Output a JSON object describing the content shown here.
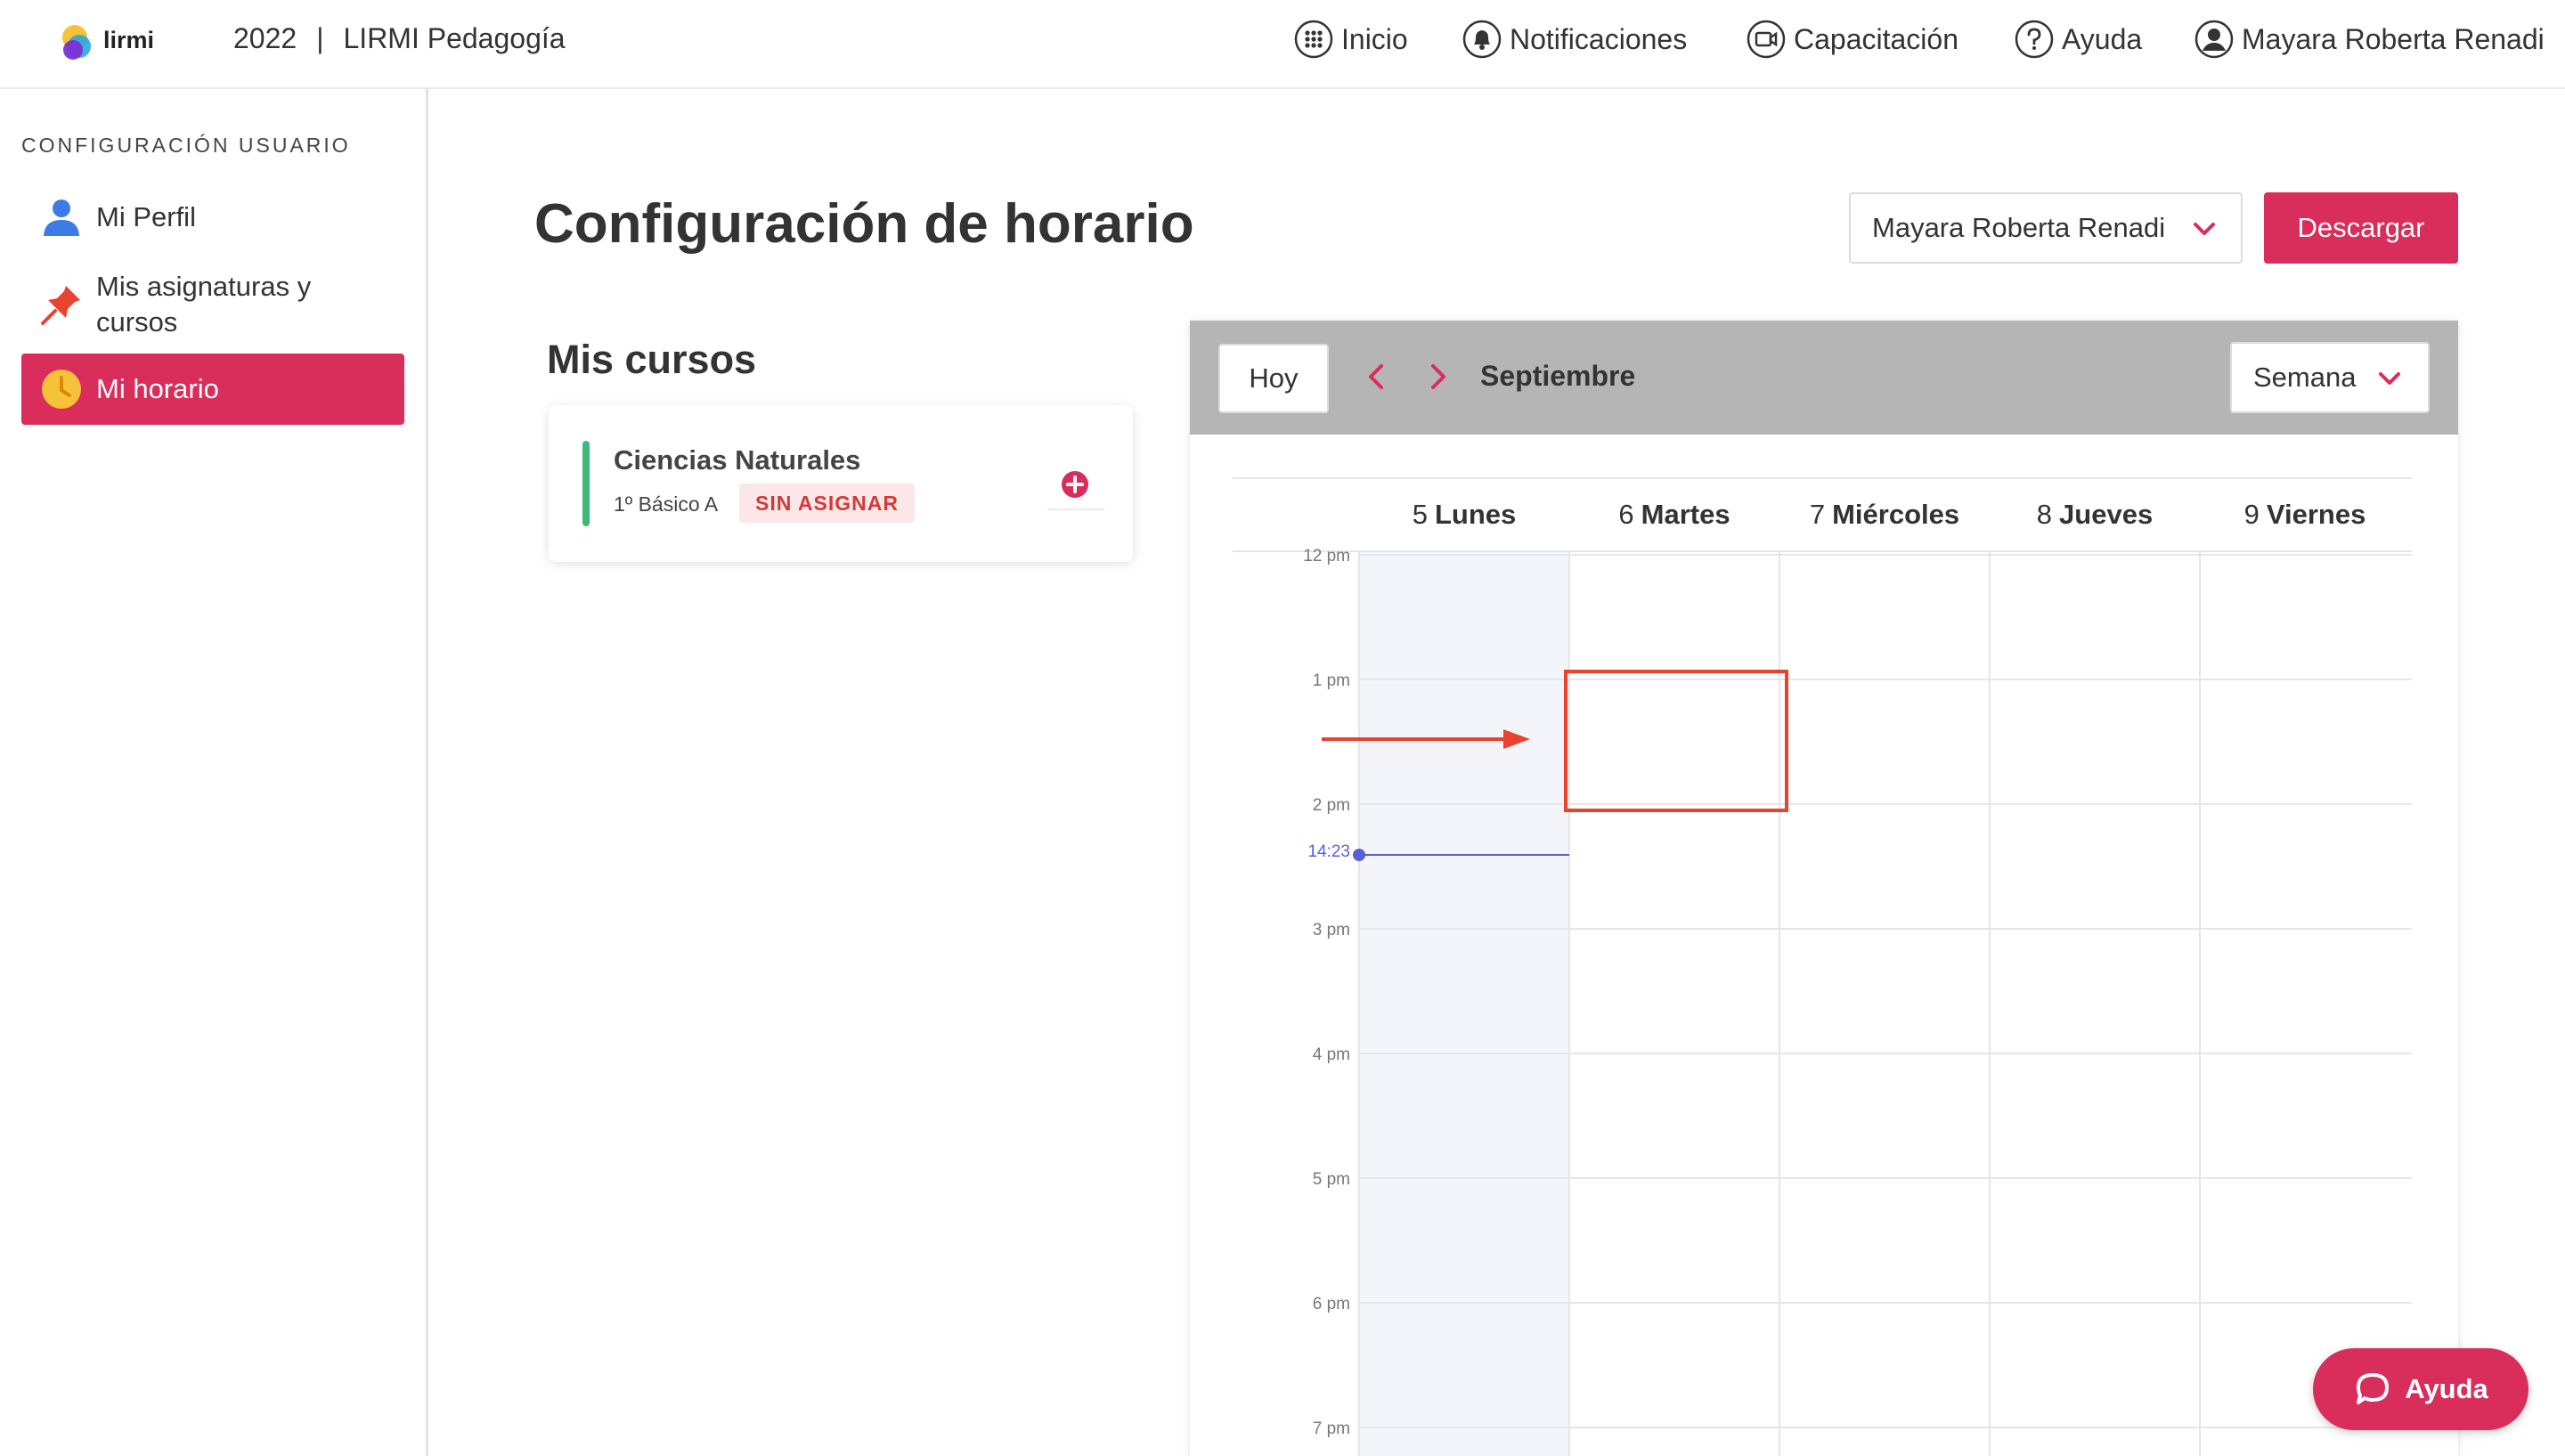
{
  "header": {
    "logo_text": "lirmi",
    "year": "2022",
    "separator": "|",
    "product": "LIRMI Pedagogía",
    "nav": [
      {
        "label": "Inicio",
        "icon": "grid-icon"
      },
      {
        "label": "Notificaciones",
        "icon": "bell-icon"
      },
      {
        "label": "Capacitación",
        "icon": "video-icon"
      },
      {
        "label": "Ayuda",
        "icon": "question-icon"
      },
      {
        "label": "Mayara Roberta Renadi",
        "icon": "user-circle-icon"
      }
    ]
  },
  "sidebar": {
    "heading": "CONFIGURACIÓN USUARIO",
    "items": [
      {
        "label": "Mi Perfil",
        "icon": "user-icon",
        "active": false
      },
      {
        "label": "Mis asignaturas y cursos",
        "icon": "pin-icon",
        "active": false
      },
      {
        "label": "Mi horario",
        "icon": "clock-icon",
        "active": true
      }
    ]
  },
  "main": {
    "title": "Configuración de horario",
    "user_select": "Mayara Roberta Renadi",
    "download_label": "Descargar",
    "courses_title": "Mis cursos",
    "courses": [
      {
        "name": "Ciencias Naturales",
        "grade": "1º Básico A",
        "status": "SIN ASIGNAR"
      }
    ]
  },
  "calendar": {
    "today_label": "Hoy",
    "month": "Septiembre",
    "view": "Semana",
    "days": [
      {
        "num": "5",
        "name": "Lunes"
      },
      {
        "num": "6",
        "name": "Martes"
      },
      {
        "num": "7",
        "name": "Miércoles"
      },
      {
        "num": "8",
        "name": "Jueves"
      },
      {
        "num": "9",
        "name": "Viernes"
      }
    ],
    "hours": [
      "12 pm",
      "1 pm",
      "2 pm",
      "3 pm",
      "4 pm",
      "5 pm",
      "6 pm",
      "7 pm"
    ],
    "now": "14:23"
  },
  "help_button": "Ayuda",
  "colors": {
    "accent": "#d92d5b",
    "course_bar": "#3dba7a",
    "badge_text": "#d23a3a",
    "now_line": "#5a5fd6",
    "annotation": "#e8432e"
  }
}
